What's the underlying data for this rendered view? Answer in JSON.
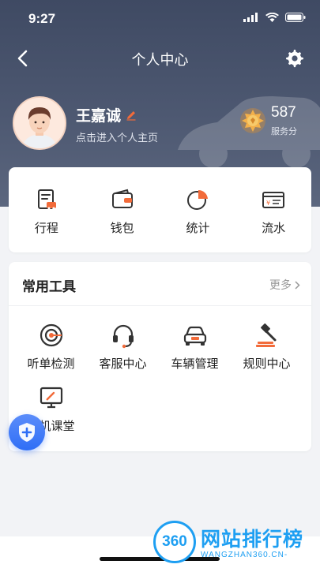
{
  "status_bar": {
    "time": "9:27"
  },
  "nav": {
    "title": "个人中心"
  },
  "profile": {
    "name": "王嘉诚",
    "subtitle": "点击进入个人主页",
    "score_value": "587",
    "score_label": "服务分"
  },
  "quick_actions": [
    {
      "label": "行程",
      "icon": "trip-icon"
    },
    {
      "label": "钱包",
      "icon": "wallet-icon"
    },
    {
      "label": "统计",
      "icon": "statistics-icon"
    },
    {
      "label": "流水",
      "icon": "bill-icon"
    }
  ],
  "tools": {
    "title": "常用工具",
    "more_label": "更多",
    "items": [
      {
        "label": "听单检测",
        "icon": "order-check-icon"
      },
      {
        "label": "客服中心",
        "icon": "headset-icon"
      },
      {
        "label": "车辆管理",
        "icon": "car-icon"
      },
      {
        "label": "规则中心",
        "icon": "gavel-icon"
      },
      {
        "label": "司机课堂",
        "icon": "classroom-icon"
      }
    ]
  },
  "watermark": {
    "badge": "360",
    "title": "网站排行榜",
    "url": "WANGZHAN360.CN-"
  },
  "colors": {
    "header": "#4a556e",
    "accent_orange": "#f26b3a",
    "fab_blue": "#2f6ef6",
    "watermark_blue": "#1e9ff2"
  }
}
